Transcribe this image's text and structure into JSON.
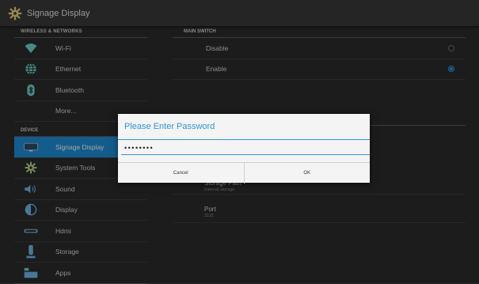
{
  "app": {
    "title": "Signage Display",
    "icon": "gear-icon"
  },
  "sidebar": {
    "section_wireless": "WIRELESS & NETWORKS",
    "section_device": "DEVICE",
    "items": [
      {
        "label": "Wi-Fi",
        "icon": "wifi-icon"
      },
      {
        "label": "Ethernet",
        "icon": "ethernet-icon"
      },
      {
        "label": "Bluetooth",
        "icon": "bluetooth-icon"
      },
      {
        "label": "More...",
        "icon": ""
      },
      {
        "label": "Signage Display",
        "icon": "display-icon",
        "selected": true
      },
      {
        "label": "System Tools",
        "icon": "tools-icon"
      },
      {
        "label": "Sound",
        "icon": "sound-icon"
      },
      {
        "label": "Display",
        "icon": "brightness-icon"
      },
      {
        "label": "Hdmi",
        "icon": "hdmi-icon"
      },
      {
        "label": "Storage",
        "icon": "storage-icon"
      },
      {
        "label": "Apps",
        "icon": "apps-icon"
      }
    ]
  },
  "main": {
    "section_switch": "MAIN SWITCH",
    "disable_label": "Disable",
    "enable_label": "Enable",
    "storage_path_label": "Storage Path",
    "storage_path_value": "Internal storage",
    "port_label": "Port",
    "port_value": "2121"
  },
  "dialog": {
    "title": "Please Enter Password",
    "password_mask": "••••••••",
    "cancel_label": "Cancel",
    "ok_label": "OK"
  },
  "colors": {
    "accent": "#1f8ed8",
    "dialog_accent": "#2f95d4"
  }
}
